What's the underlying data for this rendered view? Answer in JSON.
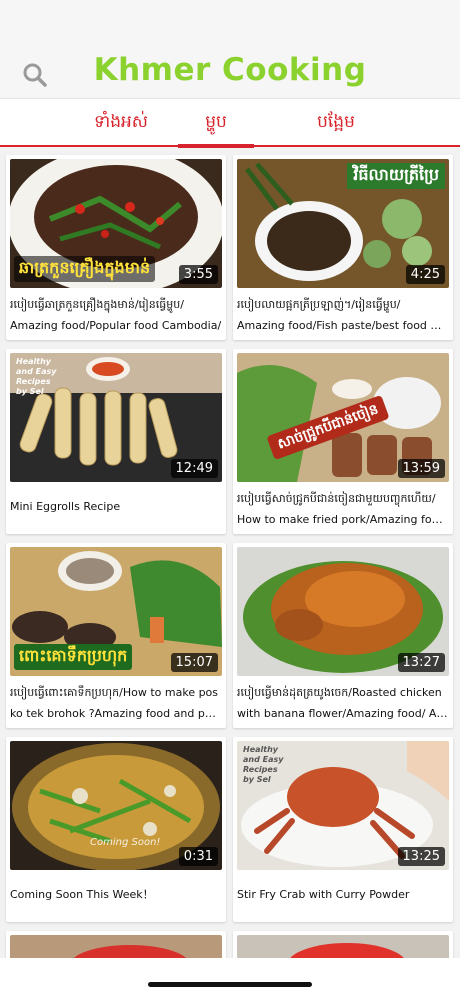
{
  "header": {
    "title": "Khmer Cooking",
    "search_icon": "search-icon"
  },
  "tabs": [
    {
      "label": "ទាំងអស់",
      "active": false
    },
    {
      "label": "ម្ហូប",
      "active": true
    },
    {
      "label": "បង្អែម",
      "active": false
    }
  ],
  "colors": {
    "accent": "#d9232c",
    "title_green": "#8bd22e"
  },
  "videos": [
    {
      "duration": "3:55",
      "overlay": "ឆាត្រកួនគ្រឿងក្នុងមាន់",
      "line1": "របៀបធ្វើឆាត្រកួនគ្រឿងក្នុងមាន់/រៀនធ្វើម្ហូប/",
      "line2": "Amazing food/Popular food Cambodia/"
    },
    {
      "duration": "4:25",
      "overlay": "វិធីលាយត្រីប្រៃ",
      "line1": "របៀបលាយផ្អកត្រីប្រឡាញ់។/រៀនធ្វើម្ហូប/",
      "line2": "Amazing food/Fish paste/best food Ca…"
    },
    {
      "duration": "12:49",
      "overlay": "Healthy and Easy Recipes by Sel",
      "line1": "Mini Eggrolls Recipe",
      "line2": ""
    },
    {
      "duration": "13:59",
      "overlay": "សាច់ជ្រូកបីជាន់ចៀន",
      "line1": "របៀបធ្វើសាច់ជ្រូកបីជាន់ចៀនជាមួយបញ្ចុកហើយ/",
      "line2": "How to make fried pork/Amazing food a…"
    },
    {
      "duration": "15:07",
      "overlay": "ពោះគោទឹកប្រហុក",
      "line1": "របៀបធ្វើពោះគោទឹកប្រហុក/How to make pos",
      "line2": "ko tek brohok ?Amazing food and popu…"
    },
    {
      "duration": "13:27",
      "overlay": "",
      "line1": "របៀបធ្វើមាន់ដុតត្រយូងចេក/Roasted chicken",
      "line2": "with banana flower/Amazing food/ Asia…"
    },
    {
      "duration": "0:31",
      "overlay": "Coming Soon!",
      "line1": "Coming Soon This Week！",
      "line2": ""
    },
    {
      "duration": "13:25",
      "overlay": "Healthy and Easy Recipes by Sel",
      "line1": "Stir Fry Crab with Curry Powder",
      "line2": ""
    }
  ]
}
